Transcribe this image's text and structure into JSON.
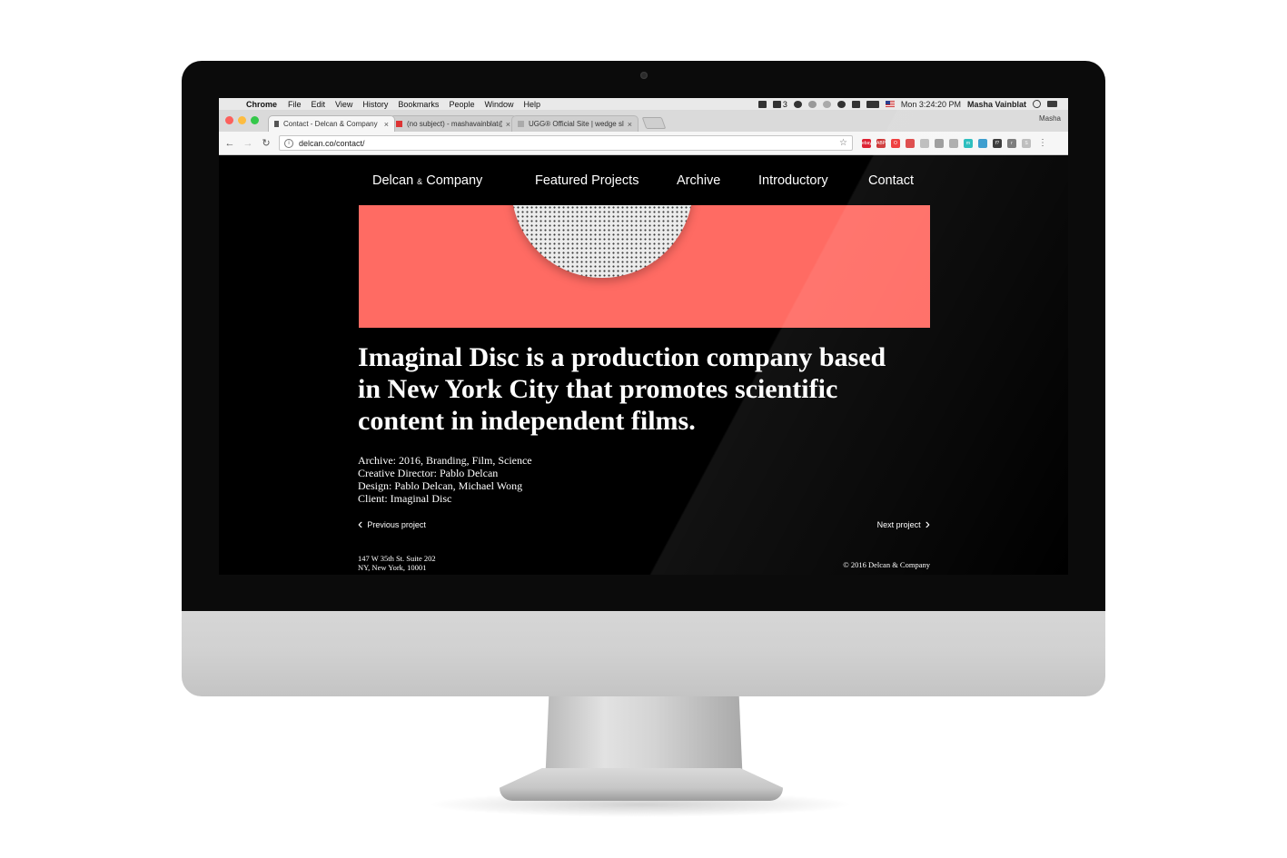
{
  "menubar": {
    "app_name": "Chrome",
    "items": [
      "File",
      "Edit",
      "View",
      "History",
      "Bookmarks",
      "People",
      "Window",
      "Help"
    ],
    "adobe_count": "3",
    "clock": "Mon 3:24:20 PM",
    "user": "Masha Vainblat"
  },
  "tabs": [
    {
      "title": "Contact - Delcan & Company",
      "close": "×"
    },
    {
      "title": "(no subject) - mashavainblat@",
      "close": "×"
    },
    {
      "title": "UGG® Official Site | wedge sl",
      "close": "×"
    }
  ],
  "profile": "Masha",
  "toolbar": {
    "back": "←",
    "forward": "→",
    "reload": "↻",
    "url": "delcan.co/contact/",
    "star": "☆",
    "menu": "⋮"
  },
  "extensions": {
    "colors": [
      "#d23",
      "#c33",
      "#e33",
      "#d44",
      "#bbb",
      "#999",
      "#aaa",
      "#2bb",
      "#39c",
      "#333",
      "#777",
      "#bbb"
    ],
    "glyphs": [
      "ebay",
      "ABP",
      "O",
      "",
      "",
      "",
      "",
      "m",
      "",
      "f?",
      "r",
      "S"
    ]
  },
  "site": {
    "brand_prefix": "Delcan",
    "brand_amp": "&",
    "brand_suffix": "Company",
    "nav": [
      "Featured Projects",
      "Archive",
      "Introductory",
      "Contact"
    ],
    "headline": "Imaginal Disc is a production company based in New York City that promotes scientific content in independent films.",
    "credits": [
      "Archive: 2016, Branding, Film, Science",
      "Creative Director: Pablo Delcan",
      "Design: Pablo Delcan, Michael Wong",
      "Client: Imaginal Disc"
    ],
    "prev_label": "Previous project",
    "next_label": "Next project",
    "address_line1": "147 W 35th St. Suite 202",
    "address_line2": "NY, New York, 10001",
    "copyright": "© 2016 Delcan & Company",
    "accent_color": "#ff6b63"
  }
}
